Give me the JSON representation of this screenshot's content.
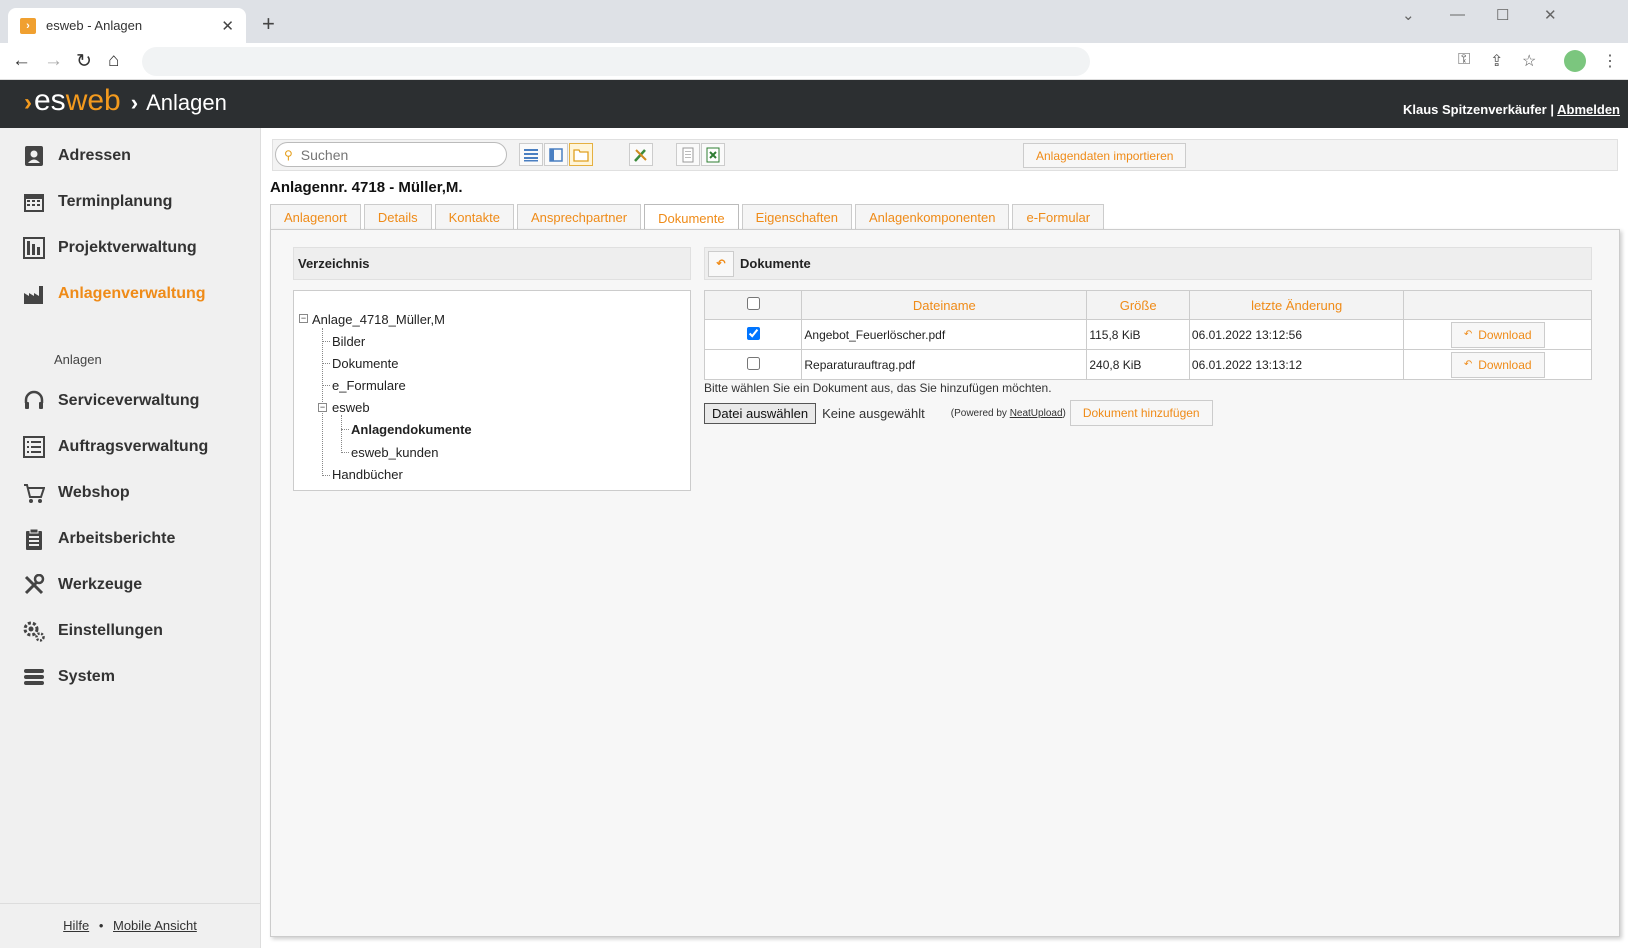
{
  "browser": {
    "tab_title": "esweb - Anlagen",
    "tab_close": "✕",
    "new_tab": "+",
    "win_min": "—",
    "win_max": "☐",
    "win_close": "✕",
    "win_down": "⌄"
  },
  "header": {
    "logo_es": "es",
    "logo_web": "web",
    "section": "Anlagen",
    "user": "Klaus Spitzenverkäufer",
    "separator": "|",
    "logout": "Abmelden"
  },
  "sidebar": {
    "items": [
      {
        "label": "Adressen",
        "icon": "address-book-icon"
      },
      {
        "label": "Terminplanung",
        "icon": "calendar-icon"
      },
      {
        "label": "Projektverwaltung",
        "icon": "project-icon"
      },
      {
        "label": "Anlagenverwaltung",
        "icon": "factory-icon",
        "active": true
      },
      {
        "label": "Serviceverwaltung",
        "icon": "headset-icon"
      },
      {
        "label": "Auftragsverwaltung",
        "icon": "list-icon"
      },
      {
        "label": "Webshop",
        "icon": "cart-icon"
      },
      {
        "label": "Arbeitsberichte",
        "icon": "clipboard-icon"
      },
      {
        "label": "Werkzeuge",
        "icon": "tools-icon"
      },
      {
        "label": "Einstellungen",
        "icon": "gears-icon"
      },
      {
        "label": "System",
        "icon": "database-icon"
      }
    ],
    "sub_item": "Anlagen",
    "footer_help": "Hilfe",
    "footer_dot": "•",
    "footer_mobile": "Mobile Ansicht"
  },
  "toolbar": {
    "search_placeholder": "Suchen",
    "import_label": "Anlagendaten importieren"
  },
  "page": {
    "title": "Anlagennr. 4718 - Müller,M.",
    "tabs": [
      "Anlagenort",
      "Details",
      "Kontakte",
      "Ansprechpartner",
      "Dokumente",
      "Eigenschaften",
      "Anlagenkomponenten",
      "e-Formular"
    ],
    "active_tab": "Dokumente"
  },
  "directory": {
    "heading": "Verzeichnis",
    "root": "Anlage_4718_Müller,M",
    "nodes": [
      "Bilder",
      "Dokumente",
      "e_Formulare",
      "esweb",
      "Anlagendokumente",
      "esweb_kunden",
      "Handbücher"
    ]
  },
  "documents": {
    "heading": "Dokumente",
    "columns": {
      "name": "Dateiname",
      "size": "Größe",
      "modified": "letzte Änderung"
    },
    "rows": [
      {
        "name": "Angebot_Feuerlöscher.pdf",
        "size": "115,8 KiB",
        "modified": "06.01.2022 13:12:56",
        "checked": true
      },
      {
        "name": "Reparaturauftrag.pdf",
        "size": "240,8 KiB",
        "modified": "06.01.2022 13:13:12",
        "checked": false
      }
    ],
    "download_label": "Download",
    "hint": "Bitte wählen Sie ein Dokument aus, das Sie hinzufügen möchten.",
    "choose_file": "Datei auswählen",
    "no_file": "Keine ausgewählt",
    "powered_prefix": "(Powered by ",
    "powered_link": "NeatUpload",
    "powered_suffix": ")",
    "add_label": "Dokument hinzufügen"
  },
  "colors": {
    "accent": "#ef8b18",
    "header_bg": "#2c2f31"
  }
}
